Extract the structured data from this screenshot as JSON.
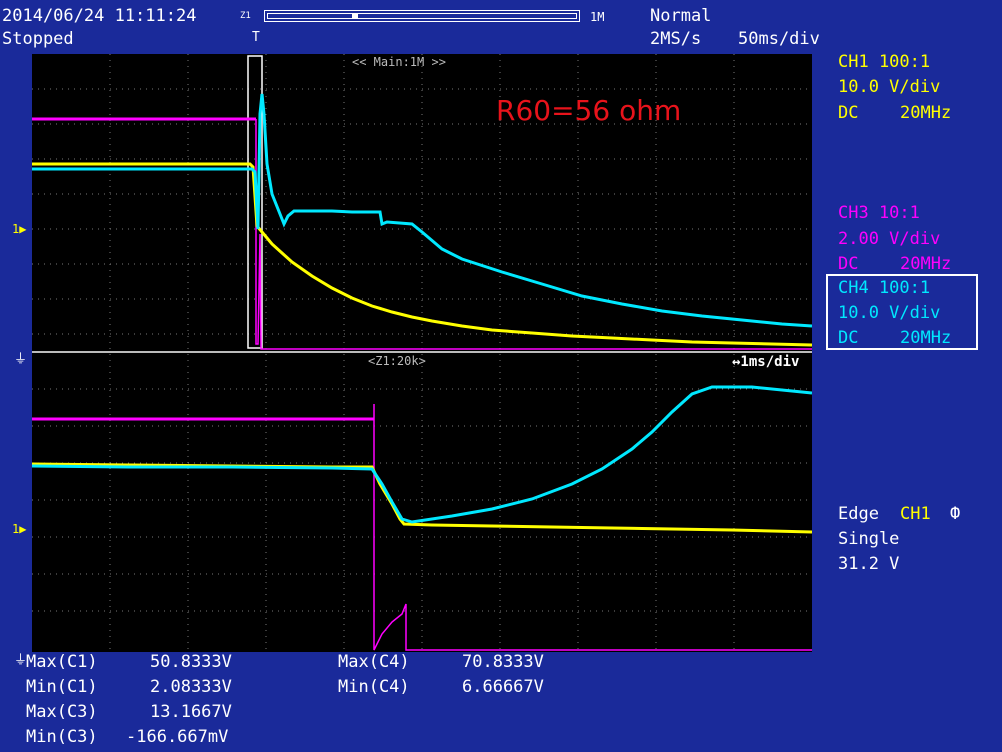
{
  "header": {
    "datetime": "2014/06/24 11:11:24",
    "status": "Stopped",
    "zoom_left_marker": "Z1",
    "zoom_right_marker": "1M",
    "trigger_mode": "Normal",
    "sample_rate": "2MS/s",
    "timebase": "50ms/div",
    "trigger_pos_marker": "T"
  },
  "main_window": {
    "label": "<< Main:1M >>",
    "annotation": "R60=56 ohm"
  },
  "zoom_window": {
    "label": "<Z1:20k>",
    "timebase": "↔1ms/div"
  },
  "channels": {
    "ch1": {
      "title": "CH1 100:1",
      "scale": "10.0 V/div",
      "coupling": "DC",
      "bw": "20MHz",
      "color": "#ffff00"
    },
    "ch3": {
      "title": "CH3 10:1",
      "scale": "2.00 V/div",
      "coupling": "DC",
      "bw": "20MHz",
      "color": "#ff00ff"
    },
    "ch4": {
      "title": "CH4 100:1",
      "scale": "10.0 V/div",
      "coupling": "DC",
      "bw": "20MHz",
      "color": "#00e8ff"
    }
  },
  "trigger": {
    "type": "Edge",
    "source": "CH1",
    "slope_icon": "rising-edge-icon",
    "mode": "Single",
    "level": "31.2 V"
  },
  "measurements": [
    {
      "label": "Max(C1)",
      "value": "50.8333V"
    },
    {
      "label": "Min(C1)",
      "value": "2.08333V"
    },
    {
      "label": "Max(C3)",
      "value": "13.1667V"
    },
    {
      "label": "Min(C3)",
      "value": "-166.667mV"
    },
    {
      "label": "Max(C4)",
      "value": "70.8333V"
    },
    {
      "label": "Min(C4)",
      "value": "6.66667V"
    }
  ],
  "markers": {
    "ch_marker_main": "1",
    "ch_marker_zoom": "1"
  }
}
